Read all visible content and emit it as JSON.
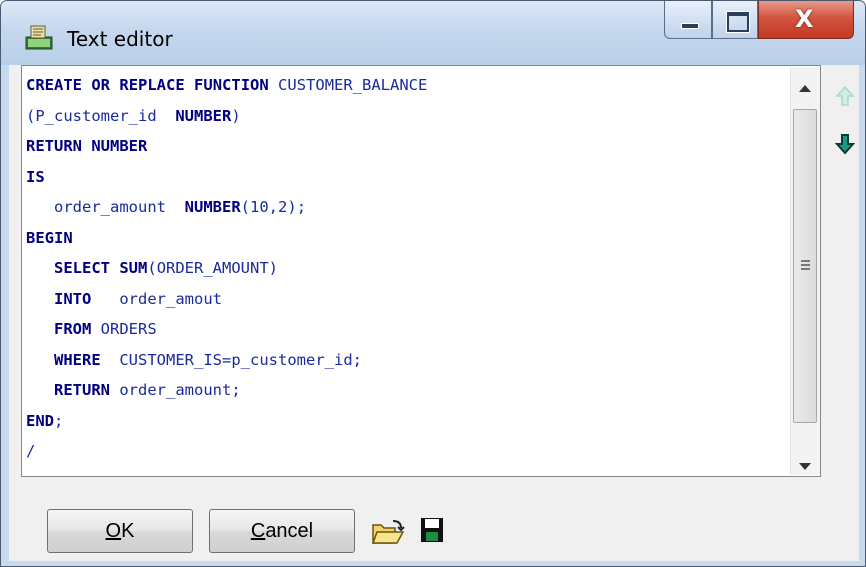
{
  "window": {
    "title": "Text editor",
    "icon": "app-icon"
  },
  "editor": {
    "lines": [
      "CREATE OR REPLACE FUNCTION CUSTOMER_BALANCE",
      "(P_customer_id  NUMBER)",
      "RETURN NUMBER",
      "IS",
      "   order_amount  NUMBER(10,2);",
      "BEGIN",
      "   SELECT SUM(ORDER_AMOUNT)",
      "   INTO   order_amout",
      "   FROM ORDERS",
      "   WHERE  CUSTOMER_IS=p_customer_id;",
      "   RETURN order_amount;",
      "END;",
      "/"
    ]
  },
  "buttons": {
    "ok_mnemonic": "O",
    "ok_rest": "K",
    "cancel_mnemonic": "C",
    "cancel_rest": "ancel"
  },
  "icons": {
    "open": "folder-open-icon",
    "save": "floppy-save-icon",
    "up": "arrow-up-icon",
    "down": "arrow-down-icon"
  },
  "colors": {
    "keyword": "#000080",
    "identifier": "#1a2b9c",
    "nav_up_disabled": "#a9d7d0",
    "nav_down": "#0a5a4c"
  }
}
